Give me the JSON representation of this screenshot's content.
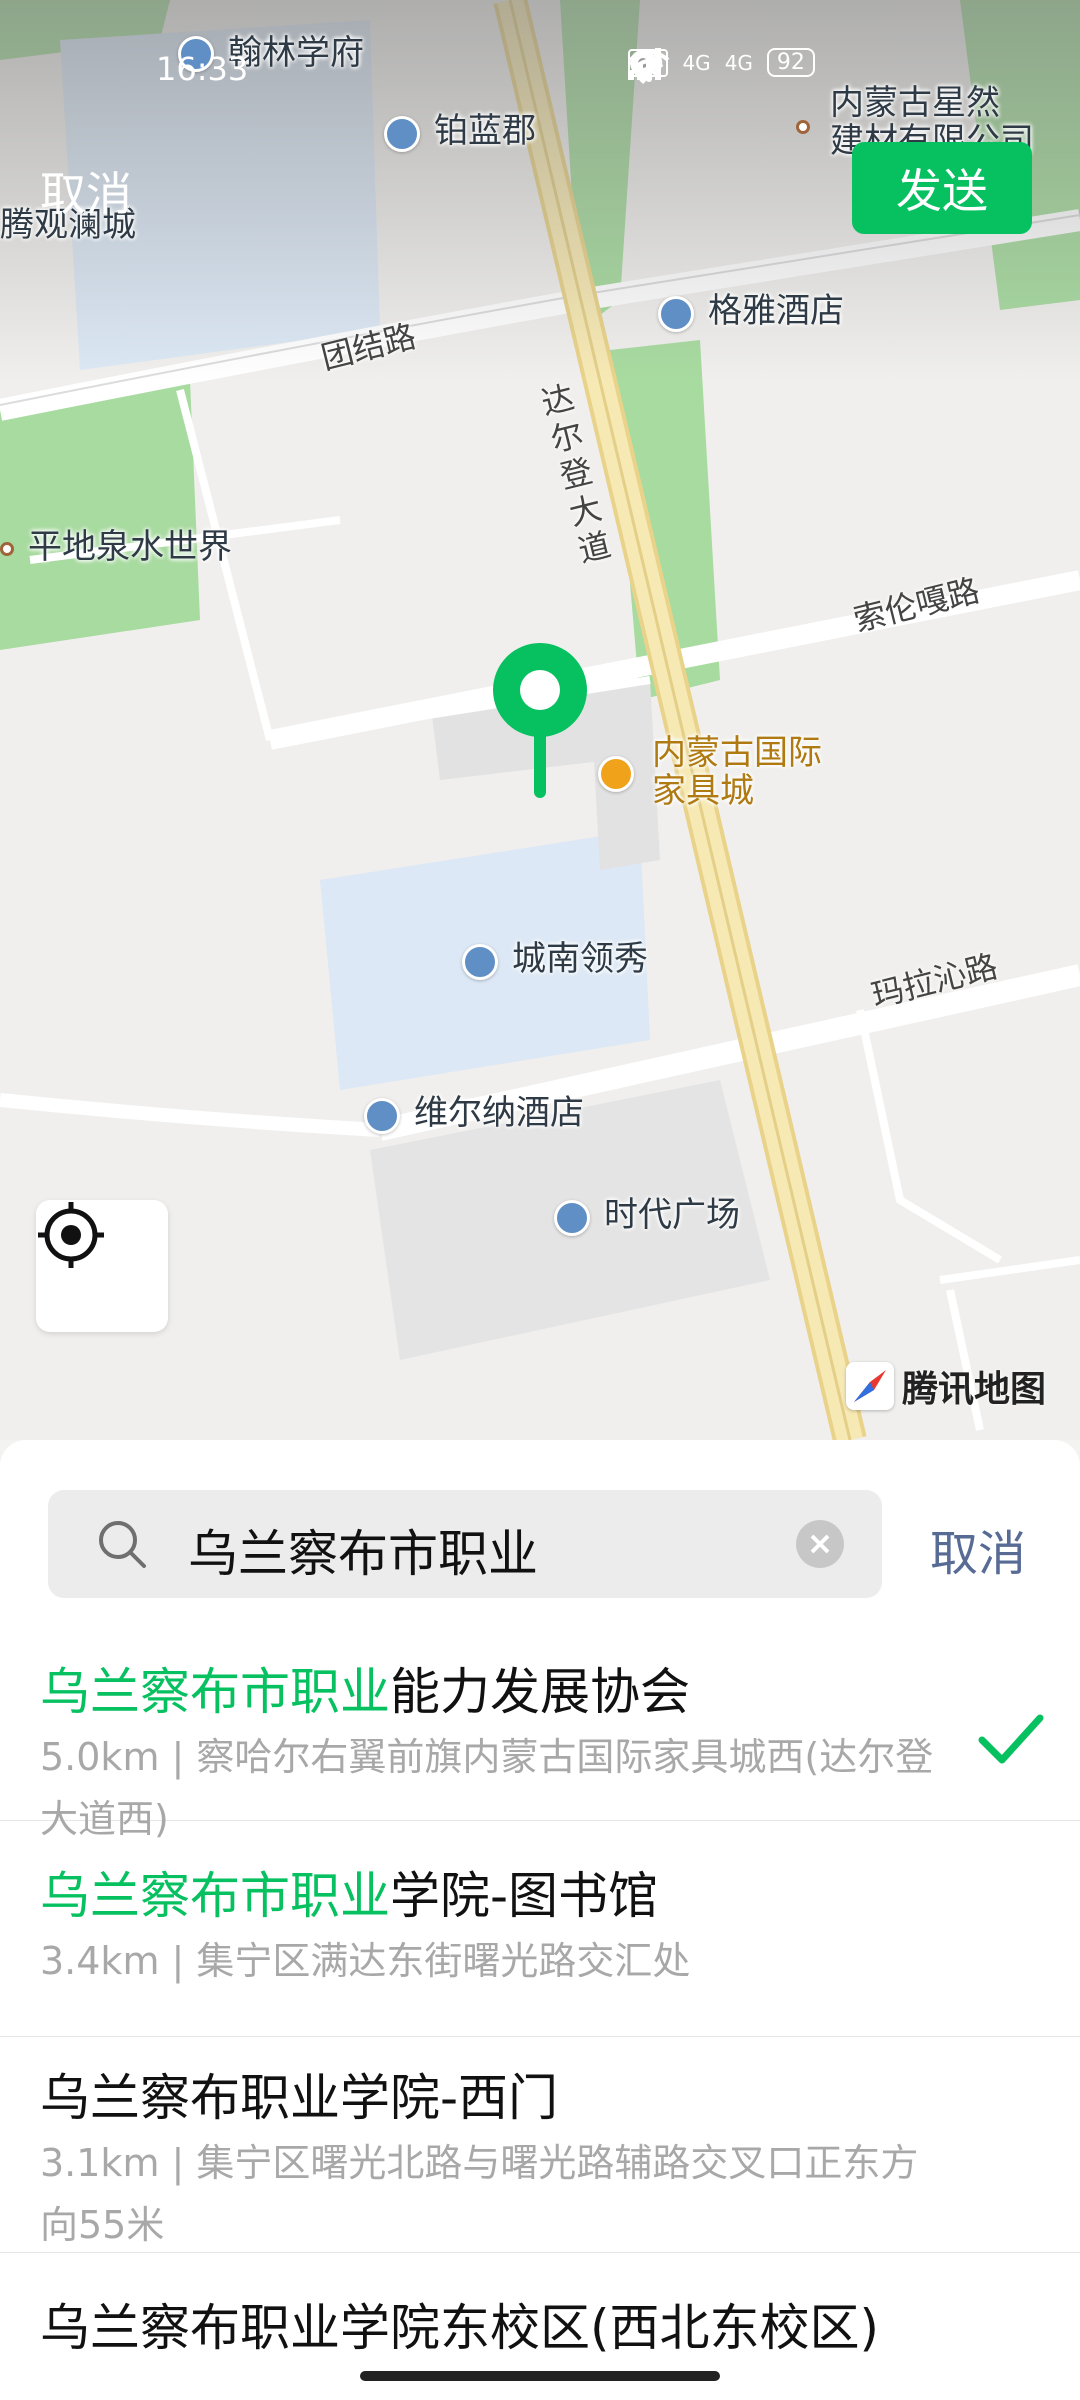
{
  "status_bar": {
    "time": "16:33",
    "network_1": "HD",
    "network_2": "4G",
    "network_3": "4G",
    "battery": "92"
  },
  "header": {
    "cancel_label": "取消",
    "send_label": "发送"
  },
  "map": {
    "pois": {
      "hanlin": "翰林学府",
      "bolanjun": "铂蓝郡",
      "xingran_1": "内蒙古星然",
      "xingran_2": "建材有限公司",
      "tengguan": "腾观澜城",
      "geya": "格雅酒店",
      "pingdi": "平地泉水世界",
      "furniture_1": "内蒙古国际",
      "furniture_2": "家具城",
      "chengnan": "城南领秀",
      "weierna": "维尔纳酒店",
      "shidai": "时代广场"
    },
    "roads": {
      "tuanjie": "团结路",
      "daerdeng": "达尔登大道",
      "suolungaga": "索伦嘎路",
      "malaqin": "玛拉沁路"
    },
    "brand": "腾讯地图",
    "colors": {
      "green_area": "#a8dba0",
      "water": "#dce8f5",
      "main_road": "#f3e3a4",
      "pin": "#07c160"
    }
  },
  "search": {
    "query": "乌兰察布市职业",
    "cancel_label": "取消"
  },
  "results": [
    {
      "title_hl": "乌兰察布市职业",
      "title_rest": "能力发展协会",
      "sub": "5.0km | 察哈尔右翼前旗内蒙古国际家具城西(达尔登大道西)",
      "selected": true
    },
    {
      "title_hl": "乌兰察布市职业",
      "title_rest": "学院-图书馆",
      "sub": "3.4km | 集宁区满达东街曙光路交汇处",
      "selected": false
    },
    {
      "title_hl": "",
      "title_rest": "乌兰察布职业学院-西门",
      "sub": "3.1km | 集宁区曙光北路与曙光路辅路交叉口正东方向55米",
      "selected": false
    },
    {
      "title_hl": "",
      "title_rest": "乌兰察布职业学院东校区(西北东校区)",
      "sub": "",
      "selected": false
    }
  ]
}
